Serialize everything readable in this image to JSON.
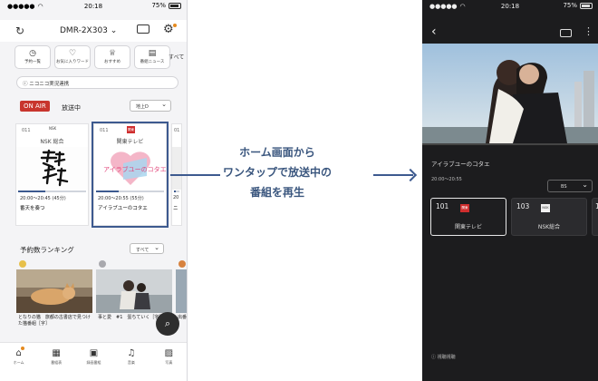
{
  "left_phone": {
    "status": {
      "carrier_dots": "●●●●●",
      "time": "20:18",
      "battery": "75%"
    },
    "header": {
      "device_name": "DMR-2X303"
    },
    "quick_buttons": [
      {
        "icon": "clock-icon",
        "label": "予約一覧"
      },
      {
        "icon": "heart-plus-icon",
        "label": "お気に入りワード"
      },
      {
        "icon": "crown-icon",
        "label": "おすすめ"
      },
      {
        "icon": "news-icon",
        "label": "番組ニュース"
      }
    ],
    "quick_all": "すべて",
    "jikkyo": "ニコニコ実況連携",
    "onair": {
      "badge": "ON AIR",
      "label": "放送中",
      "filter": "地上D"
    },
    "cards": [
      {
        "ch_no": "011",
        "logo": "NSK",
        "ch_name": "NSK 総合",
        "time": "20:00～20:45 (45分)",
        "title": "番天を奏つ",
        "progress": 0.4
      },
      {
        "ch_no": "011",
        "logo": "関東",
        "ch_name": "関東テレビ",
        "time": "20:00～20:55 (55分)",
        "title": "アイラブユーのコタエ",
        "progress": 0.33
      },
      {
        "ch_no": "01",
        "logo": "",
        "ch_name": "",
        "time": "20",
        "title": "ニ",
        "progress": 0.3
      }
    ],
    "ranking": {
      "title": "予約数ランキング",
      "filter": "すべて",
      "items": [
        {
          "medal": "gold",
          "text": "となりの猫　旅都の古書店で見つけた猫番組［字］"
        },
        {
          "medal": "silver",
          "text": "事と愛　#1　蛋ちていく［字］"
        },
        {
          "medal": "bronze",
          "text": "出番"
        }
      ]
    },
    "tabs": [
      {
        "icon": "home-icon",
        "label": "ホーム"
      },
      {
        "icon": "guide-icon",
        "label": "番組表"
      },
      {
        "icon": "recorded-icon",
        "label": "録画番組"
      },
      {
        "icon": "music-icon",
        "label": "音楽"
      },
      {
        "icon": "photo-icon",
        "label": "写真"
      }
    ]
  },
  "caption": [
    "ホーム画面から",
    "ワンタップで放送中の",
    "番組を再生"
  ],
  "right_phone": {
    "status": {
      "carrier_dots": "●●●●●",
      "time": "20:18",
      "battery": "75%"
    },
    "program_title": "アイラブユーのコタエ",
    "time": "20:00～20:55",
    "band": "BS",
    "channels": [
      {
        "no": "101",
        "logo": "関東",
        "name": "関東テレビ"
      },
      {
        "no": "103",
        "logo": "NSK",
        "name": "NSK総合"
      },
      {
        "no": "1",
        "logo": "",
        "name": ""
      }
    ],
    "footer": "ⓘ 視聴視聴"
  },
  "colors": {
    "accent": "#3d5a8f",
    "onair": "#c8352e",
    "dark_bg": "#1c1c1e"
  }
}
